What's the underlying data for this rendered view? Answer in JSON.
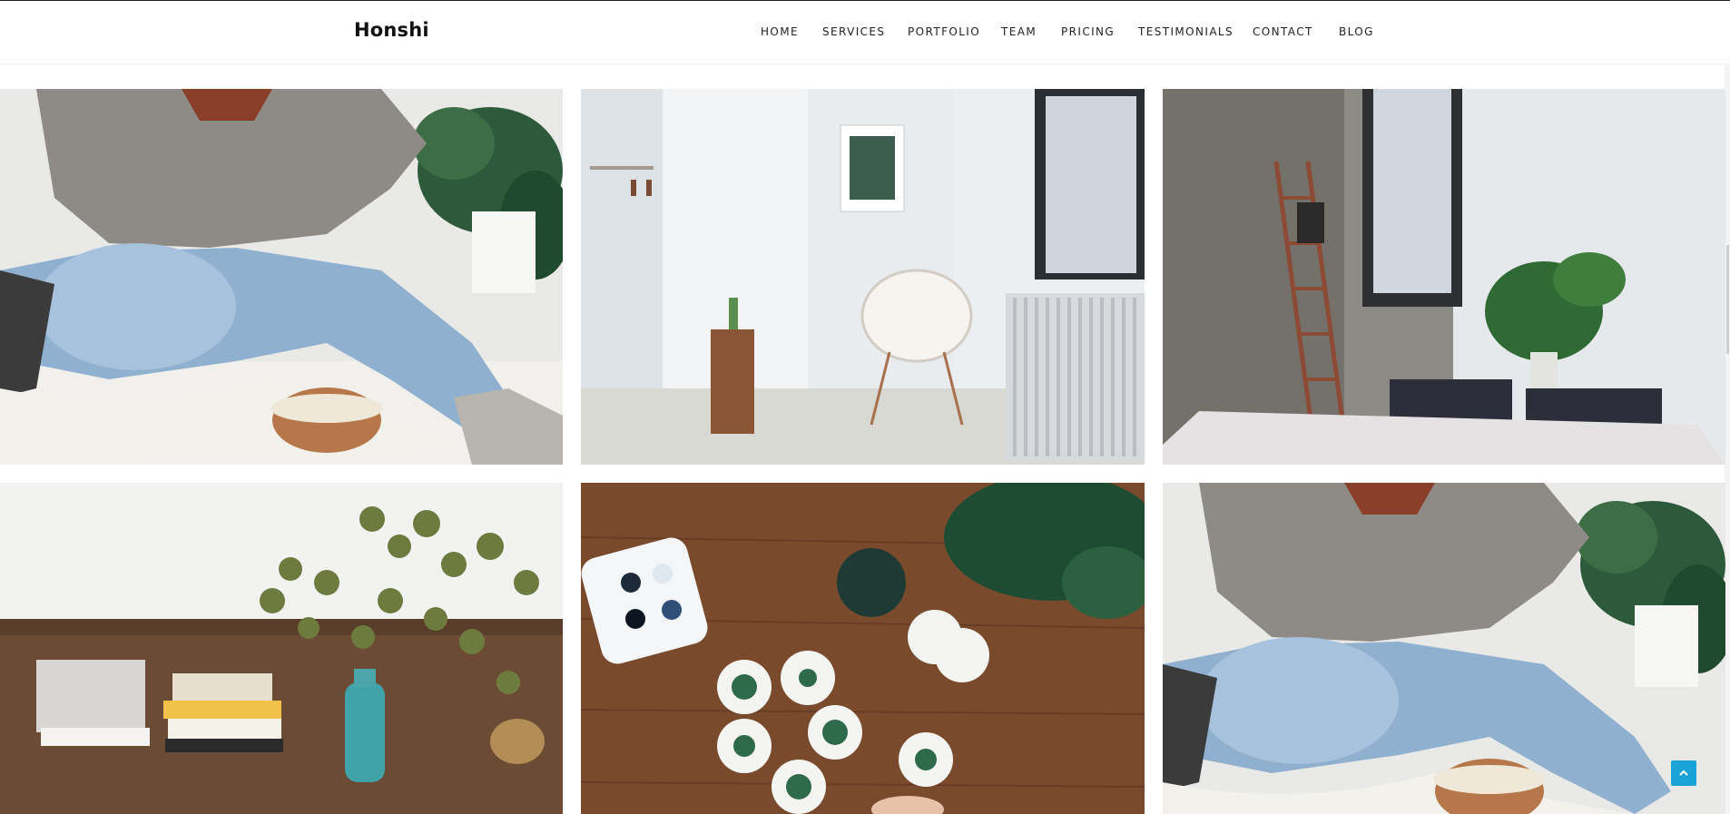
{
  "header": {
    "brand": "Honshi",
    "nav": [
      "HOME",
      "SERVICES",
      "PORTFOLIO",
      "TEAM",
      "PRICING",
      "TESTIMONIALS",
      "CONTACT",
      "BLOG"
    ]
  },
  "colors": {
    "accent": "#1aa3d6",
    "text": "#222222",
    "background": "#ffffff"
  },
  "gallery": {
    "items": [
      {
        "icon": "photo-woman-popcorn"
      },
      {
        "icon": "photo-white-room-chair"
      },
      {
        "icon": "photo-concrete-room-ladder"
      },
      {
        "icon": "photo-table-books-eucalyptus"
      },
      {
        "icon": "photo-wood-table-watercolor"
      },
      {
        "icon": "photo-woman-popcorn"
      }
    ]
  },
  "back_to_top": {
    "icon": "chevron-up-icon"
  }
}
